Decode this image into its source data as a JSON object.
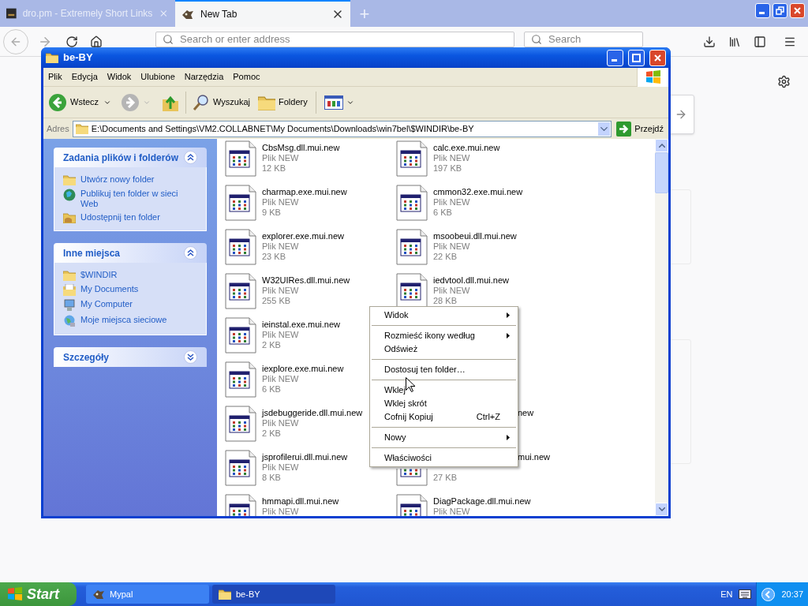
{
  "browser": {
    "tabs": [
      {
        "title": "dro.pm - Extremely Short Links",
        "kind": "site",
        "selected": false
      },
      {
        "title": "New Tab",
        "kind": "mypal",
        "selected": true
      }
    ],
    "new_tab": "+",
    "address": {
      "placeholder": "Search or enter address"
    },
    "search": {
      "placeholder": "Search"
    }
  },
  "explorer": {
    "title": "be-BY",
    "menu": [
      "Plik",
      "Edycja",
      "Widok",
      "Ulubione",
      "Narzędzia",
      "Pomoc"
    ],
    "toolbar": {
      "back": "Wstecz",
      "search": "Wyszukaj",
      "folders": "Foldery"
    },
    "address": {
      "label": "Adres",
      "value": "E:\\Documents and Settings\\VM2.COLLABNET\\My Documents\\Downloads\\win7bel\\$WINDIR\\be-BY",
      "go": "Przejdź"
    },
    "panels": [
      {
        "title": "Zadania plików i folderów",
        "expanded": true,
        "items": [
          {
            "label": "Utwórz nowy folder",
            "kind": "new-folder"
          },
          {
            "label": "Publikuj ten folder w sieci Web",
            "kind": "publish"
          },
          {
            "label": "Udostępnij ten folder",
            "kind": "share"
          }
        ]
      },
      {
        "title": "Inne miejsca",
        "expanded": true,
        "items": [
          {
            "label": "$WINDIR",
            "kind": "folder"
          },
          {
            "label": "My Documents",
            "kind": "documents"
          },
          {
            "label": "My Computer",
            "kind": "computer"
          },
          {
            "label": "Moje miejsca sieciowe",
            "kind": "network"
          }
        ]
      },
      {
        "title": "Szczegóły",
        "expanded": false
      }
    ],
    "files": [
      {
        "cells": [
          {
            "name": "CbsMsg.dll.mui.new",
            "type": "Plik NEW",
            "size": "12 KB"
          },
          {
            "name": "calc.exe.mui.new",
            "type": "Plik NEW",
            "size": "197 KB"
          }
        ]
      },
      {
        "cells": [
          {
            "name": "charmap.exe.mui.new",
            "type": "Plik NEW",
            "size": "9 KB"
          },
          {
            "name": "cmmon32.exe.mui.new",
            "type": "Plik NEW",
            "size": "6 KB"
          }
        ]
      },
      {
        "cells": [
          {
            "name": "explorer.exe.mui.new",
            "type": "Plik NEW",
            "size": "23 KB"
          },
          {
            "name": "msoobeui.dll.mui.new",
            "type": "Plik NEW",
            "size": "22 KB"
          }
        ]
      },
      {
        "cells": [
          {
            "name": "W32UIRes.dll.mui.new",
            "type": "Plik NEW",
            "size": "255 KB"
          },
          {
            "name": "iedvtool.dll.mui.new",
            "type": "Plik NEW",
            "size": "28 KB"
          }
        ]
      },
      {
        "cells": [
          {
            "name": "ieinstal.exe.mui.new",
            "type": "Plik NEW",
            "size": "2 KB"
          }
        ]
      },
      {
        "cells": [
          {
            "name": "iexplore.exe.mui.new",
            "type": "Plik NEW",
            "size": "6 KB"
          }
        ]
      },
      {
        "cells": [
          {
            "name": "jsdebuggeride.dll.mui.new",
            "type": "Plik NEW",
            "size": "2 KB"
          },
          {
            "name": "new",
            "cut": true
          }
        ]
      },
      {
        "cells": [
          {
            "name": "jsprofilerui.dll.mui.new",
            "type": "Plik NEW",
            "size": "8 KB"
          },
          {
            "name": "mui.new",
            "cut": true,
            "size": "27 KB"
          }
        ]
      },
      {
        "cells": [
          {
            "name": "hmmapi.dll.mui.new",
            "type": "Plik NEW"
          },
          {
            "name": "DiagPackage.dll.mui.new",
            "type": "Plik NEW"
          }
        ]
      }
    ]
  },
  "context_menu": {
    "groups": [
      {
        "items": [
          {
            "label": "Widok",
            "submenu": true
          }
        ]
      },
      {
        "items": [
          {
            "label": "Rozmieść ikony według",
            "submenu": true
          },
          {
            "label": "Odśwież",
            "submenu": false
          }
        ]
      },
      {
        "items": [
          {
            "label": "Dostosuj ten folder…",
            "submenu": false
          }
        ]
      },
      {
        "items": [
          {
            "label": "Wklej",
            "submenu": false
          },
          {
            "label": "Wklej skrót",
            "submenu": false
          },
          {
            "label": "Cofnij Kopiuj",
            "submenu": false,
            "shortcut": "Ctrl+Z"
          }
        ]
      },
      {
        "items": [
          {
            "label": "Nowy",
            "submenu": true
          }
        ]
      },
      {
        "items": [
          {
            "label": "Właściwości",
            "submenu": false
          }
        ]
      }
    ]
  },
  "taskbar": {
    "start": "Start",
    "tasks": [
      {
        "label": "Mypal",
        "kind": "browser",
        "selected": false
      },
      {
        "label": "be-BY",
        "kind": "folder",
        "selected": true
      }
    ],
    "language": "EN",
    "clock": "20:37"
  }
}
